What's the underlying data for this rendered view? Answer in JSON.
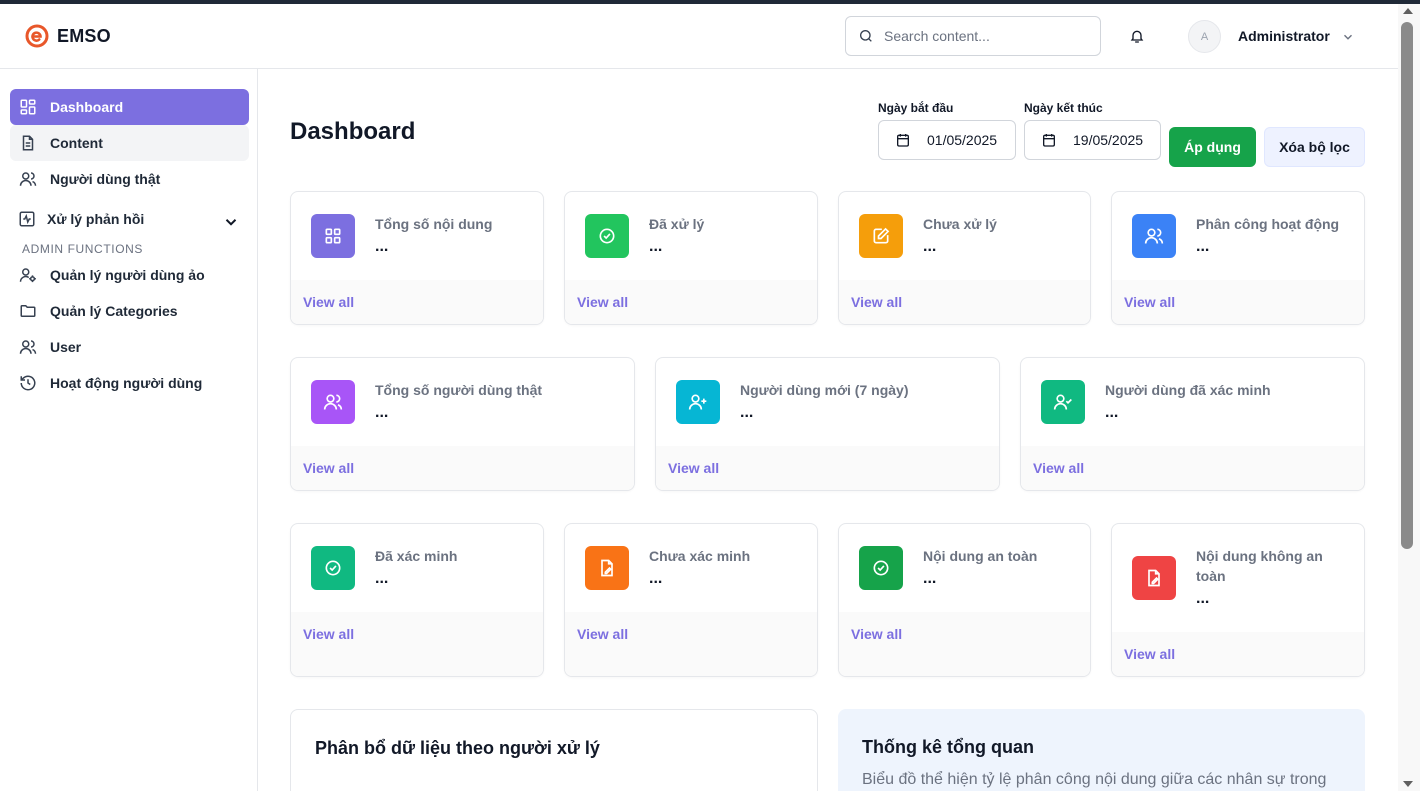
{
  "header": {
    "brand": "EMSO",
    "brand_color": "#e8572a",
    "search_placeholder": "Search content...",
    "avatar_letter": "A",
    "user_name": "Administrator"
  },
  "sidebar": {
    "items": [
      {
        "label": "Dashboard",
        "icon": "grid-icon",
        "active": true
      },
      {
        "label": "Content",
        "icon": "document-icon"
      },
      {
        "label": "Người dùng thật",
        "icon": "users-icon"
      },
      {
        "label": "Xử lý phản hồi",
        "icon": "activity-icon",
        "expandable": true
      }
    ],
    "section_title": "ADMIN FUNCTIONS",
    "admin_items": [
      {
        "label": "Quản lý người dùng ảo",
        "icon": "user-cog-icon"
      },
      {
        "label": "Quản lý Categories",
        "icon": "folder-icon"
      },
      {
        "label": "User",
        "icon": "users-icon"
      },
      {
        "label": "Hoạt động người dùng",
        "icon": "history-icon"
      }
    ]
  },
  "main": {
    "title": "Dashboard",
    "filters": {
      "start_label": "Ngày bắt đầu",
      "start_value": "01/05/2025",
      "end_label": "Ngày kết thúc",
      "end_value": "19/05/2025",
      "apply_label": "Áp dụng",
      "clear_label": "Xóa bộ lọc"
    },
    "view_all": "View all",
    "cards_row1": [
      {
        "title": "Tổng số nội dung",
        "value": "...",
        "icon": "grid-icon",
        "color": "#7c6fe0"
      },
      {
        "title": "Đã xử lý",
        "value": "...",
        "icon": "check-circle-icon",
        "color": "#22c55e"
      },
      {
        "title": "Chưa xử lý",
        "value": "...",
        "icon": "edit-icon",
        "color": "#f59e0b"
      },
      {
        "title": "Phân công hoạt động",
        "value": "...",
        "icon": "users-icon",
        "color": "#3b82f6"
      }
    ],
    "cards_row2": [
      {
        "title": "Tổng số người dùng thật",
        "value": "...",
        "icon": "users-icon",
        "color": "#a855f7"
      },
      {
        "title": "Người dùng mới (7 ngày)",
        "value": "...",
        "icon": "user-plus-icon",
        "color": "#06b6d4"
      },
      {
        "title": "Người dùng đã xác minh",
        "value": "...",
        "icon": "user-check-icon",
        "color": "#10b981"
      }
    ],
    "cards_row3": [
      {
        "title": "Đã xác minh",
        "value": "...",
        "icon": "check-circle-icon",
        "color": "#10b981"
      },
      {
        "title": "Chưa xác minh",
        "value": "...",
        "icon": "file-edit-icon",
        "color": "#f97316"
      },
      {
        "title": "Nội dung an toàn",
        "value": "...",
        "icon": "check-circle-icon",
        "color": "#16a34a"
      },
      {
        "title": "Nội dung không an toàn",
        "value": "...",
        "icon": "file-edit-icon",
        "color": "#ef4444"
      }
    ],
    "panel_left": {
      "title": "Phân bổ dữ liệu theo người xử lý"
    },
    "panel_right": {
      "title": "Thống kê tổng quan",
      "text": "Biểu đồ thể hiện tỷ lệ phân công nội dung giữa các nhân sự trong"
    }
  }
}
